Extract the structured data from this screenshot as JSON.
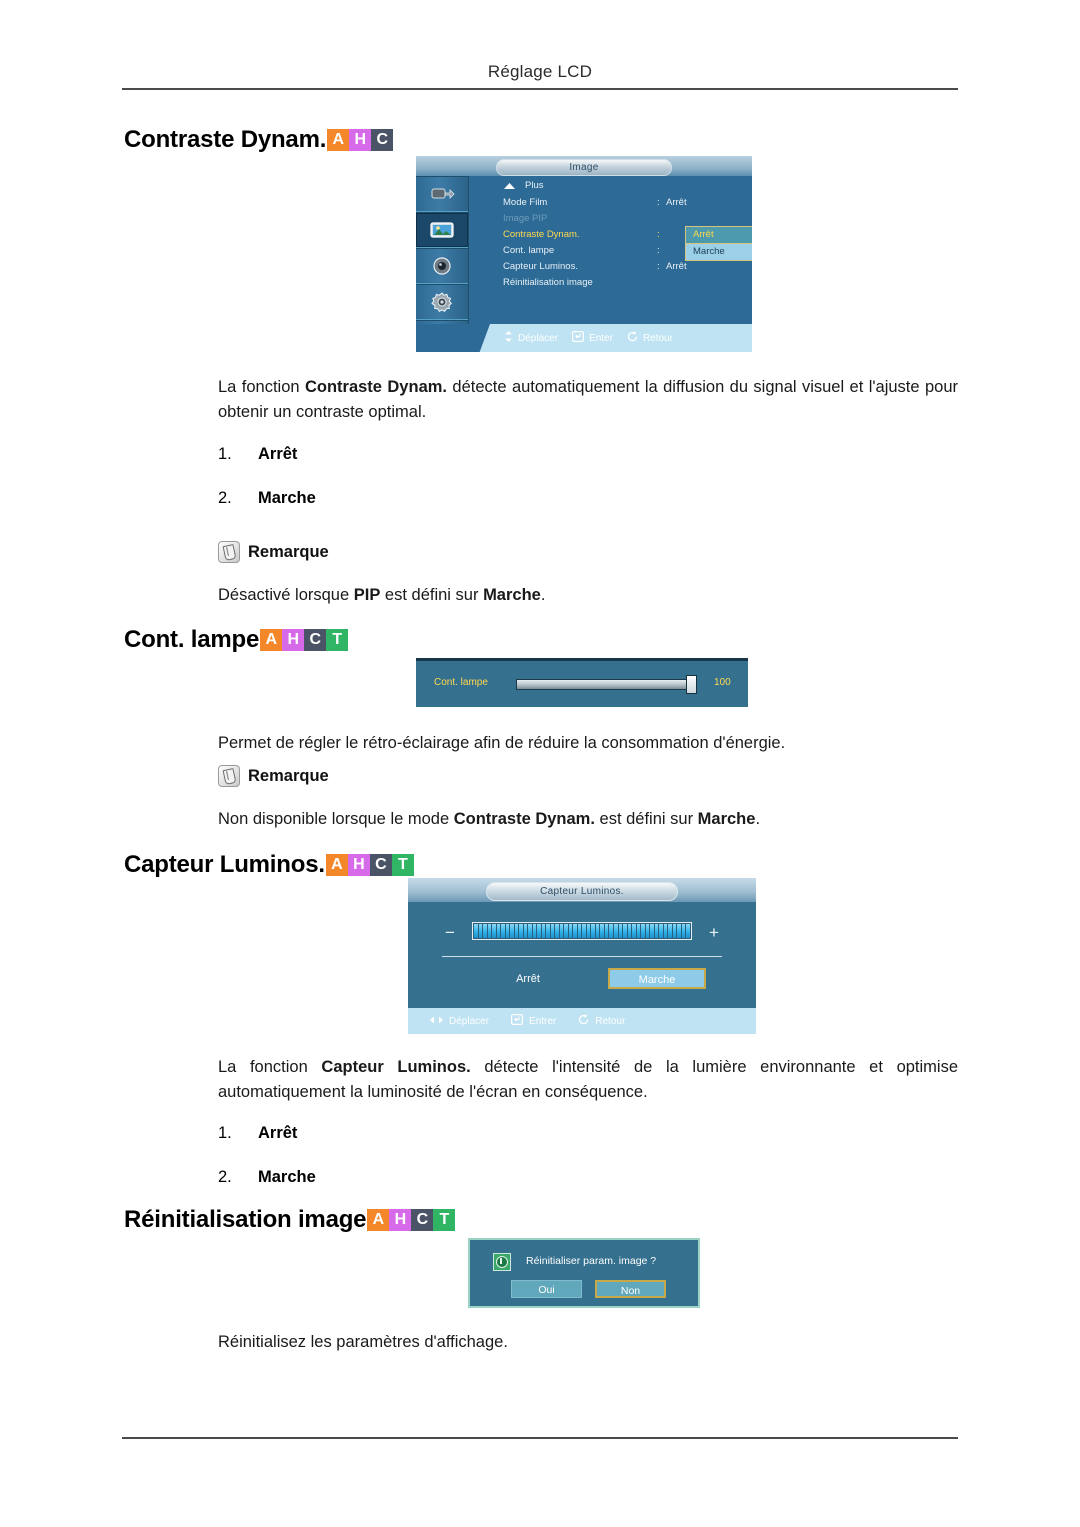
{
  "header": {
    "running_title": "Réglage LCD"
  },
  "sections": {
    "dynamic_contrast": {
      "heading": "Contraste Dynam.",
      "badges": [
        "A",
        "H",
        "C"
      ],
      "paragraph_prefix": "La fonction ",
      "paragraph_bold": "Contraste Dynam.",
      "paragraph_suffix": " détecte automatiquement la diffusion du signal visuel et l'ajuste pour obtenir un contraste optimal.",
      "items": [
        {
          "num": "1.",
          "label": "Arrêt"
        },
        {
          "num": "2.",
          "label": "Marche"
        }
      ],
      "note_title": "Remarque",
      "note_prefix": "Désactivé lorsque ",
      "note_bold1": "PIP",
      "note_mid": " est défini sur ",
      "note_bold2": "Marche",
      "note_suffix": "."
    },
    "lamp_control": {
      "heading": "Cont. lampe",
      "badges": [
        "A",
        "H",
        "C",
        "T"
      ],
      "paragraph": "Permet de régler le rétro-éclairage afin de réduire la consommation d'énergie.",
      "note_title": "Remarque",
      "note_prefix": "Non disponible lorsque le mode ",
      "note_bold1": "Contraste Dynam.",
      "note_mid": " est défini sur ",
      "note_bold2": "Marche",
      "note_suffix": "."
    },
    "brightness_sensor": {
      "heading": "Capteur Luminos.",
      "badges": [
        "A",
        "H",
        "C",
        "T"
      ],
      "paragraph_prefix": "La fonction ",
      "paragraph_bold": "Capteur Luminos.",
      "paragraph_suffix": " détecte l'intensité de la lumière environnante et optimise automatiquement la luminosité de l'écran en conséquence.",
      "items": [
        {
          "num": "1.",
          "label": "Arrêt"
        },
        {
          "num": "2.",
          "label": "Marche"
        }
      ]
    },
    "image_reset": {
      "heading": "Réinitialisation image",
      "badges": [
        "A",
        "H",
        "C",
        "T"
      ],
      "paragraph": "Réinitialisez les paramètres d'affichage."
    }
  },
  "osd_menu": {
    "title": "Image",
    "more_label": "Plus",
    "rows": [
      {
        "label": "Mode Film",
        "colon": ":",
        "value": "Arrêt"
      },
      {
        "label": "Image PIP",
        "colon": "",
        "value": ""
      },
      {
        "label": "Contraste Dynam.",
        "colon": ":",
        "value": ""
      },
      {
        "label": "Cont. lampe",
        "colon": ":",
        "value": ""
      },
      {
        "label": "Capteur Luminos.",
        "colon": ":",
        "value": "Arrêt"
      },
      {
        "label": "Réinitialisation image",
        "colon": "",
        "value": ""
      }
    ],
    "dropdown": {
      "selected": "Arrêt",
      "other": "Marche"
    },
    "footer": [
      {
        "icon": "dpad-updown-icon",
        "label": "Déplacer"
      },
      {
        "icon": "enter-key-icon",
        "label": "Enter"
      },
      {
        "icon": "return-arrow-icon",
        "label": "Retour"
      }
    ],
    "sidebar_icons": [
      "input-source-icon",
      "picture-icon",
      "sound-icon",
      "setup-gear-icon",
      "multi-control-icon"
    ]
  },
  "osd_slider": {
    "label": "Cont. lampe",
    "value": "100",
    "fill_percent": 100
  },
  "osd_sensor": {
    "title": "Capteur Luminos.",
    "minus": "−",
    "plus": "+",
    "off_label": "Arrêt",
    "on_label": "Marche",
    "segments": 48,
    "footer": [
      {
        "icon": "dpad-leftright-icon",
        "label": "Déplacer"
      },
      {
        "icon": "enter-key-icon",
        "label": "Entrer"
      },
      {
        "icon": "return-arrow-icon",
        "label": "Retour"
      }
    ]
  },
  "osd_dialog": {
    "message": "Réinitialiser param. image ?",
    "yes_label": "Oui",
    "no_label": "Non"
  },
  "colors": {
    "badge_a": "#f5872b",
    "badge_h": "#d66ae8",
    "badge_c": "#4b5466",
    "badge_t": "#2fb564",
    "osd_bg": "#2d6a96",
    "osd_panel": "#35718f",
    "osd_highlight_text": "#ffd84d",
    "osd_footer_bg": "#bfe3f2",
    "osd_focus_border": "#c8a94a"
  }
}
